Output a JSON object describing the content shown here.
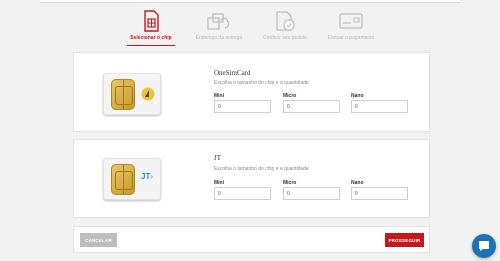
{
  "steps": [
    {
      "label": "Selecionar o chip",
      "icon": "sim-card-icon",
      "active": true
    },
    {
      "label": "Endereço da entrega",
      "icon": "delivery-icon",
      "active": false
    },
    {
      "label": "Conferir seu pedido",
      "icon": "order-check-icon",
      "active": false
    },
    {
      "label": "Efetuar o pagamento",
      "icon": "payment-card-icon",
      "active": false
    }
  ],
  "products": [
    {
      "name": "OneSimCard",
      "subtitle": "Escolha o tamanho do chip e a quantidade",
      "fields": [
        {
          "label": "Mini",
          "value": "0"
        },
        {
          "label": "Micro",
          "value": "0"
        },
        {
          "label": "Nano",
          "value": "0"
        }
      ]
    },
    {
      "name": "JT",
      "subtitle": "Escolha o tamanho do chip e a quantidade",
      "logo_text": "JT",
      "fields": [
        {
          "label": "Mini",
          "value": "0"
        },
        {
          "label": "Micro",
          "value": "0"
        },
        {
          "label": "Nano",
          "value": "0"
        }
      ]
    }
  ],
  "footer": {
    "cancel_label": "CANCELAR",
    "proceed_label": "PROSSEGUIR"
  },
  "colors": {
    "accent": "#c8161d",
    "chat": "#1b73b7",
    "muted": "#bdbdbd"
  }
}
